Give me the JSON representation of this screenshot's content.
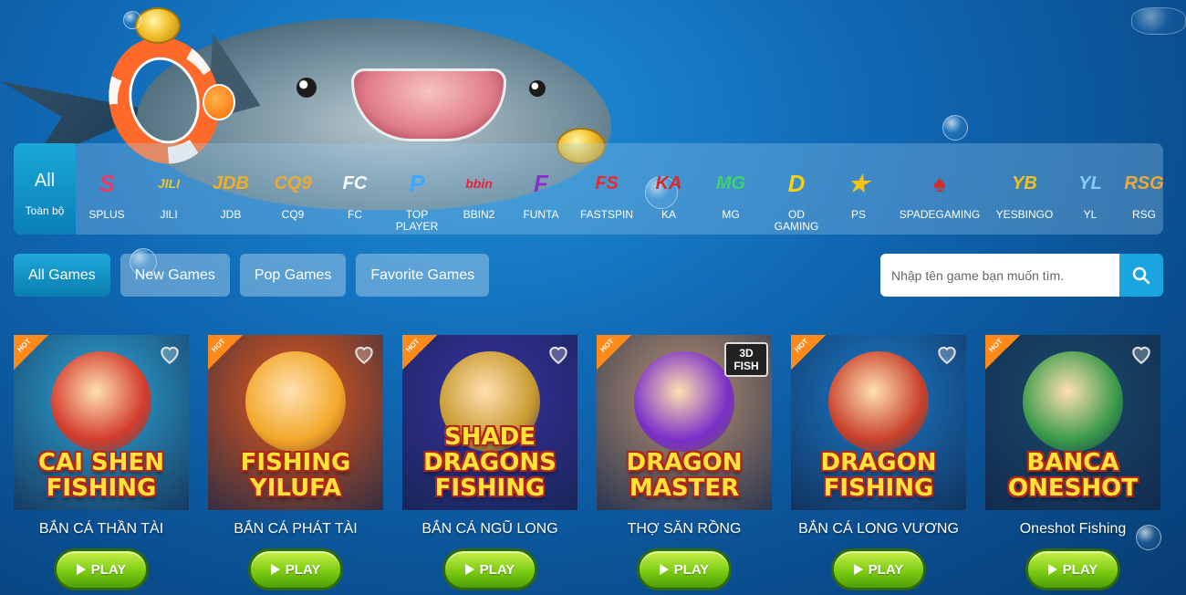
{
  "providers": {
    "all_big": "All",
    "all_small": "Toàn bộ",
    "items": [
      {
        "label": "SPLUS",
        "logo_text": "S",
        "color": "#e83b6a"
      },
      {
        "label": "JILI",
        "logo_text": "JILI",
        "color": "#f2c230"
      },
      {
        "label": "JDB",
        "logo_text": "JDB",
        "color": "#f2b01e"
      },
      {
        "label": "CQ9",
        "logo_text": "CQ9",
        "color": "#f0a830"
      },
      {
        "label": "FC",
        "logo_text": "FC",
        "color": "#ffffff"
      },
      {
        "label": "TOP PLAYER",
        "logo_text": "P",
        "color": "#3aa8ff"
      },
      {
        "label": "BBIN2",
        "logo_text": "bbin",
        "color": "#e8203c"
      },
      {
        "label": "FUNTA",
        "logo_text": "F",
        "color": "#8a2fc8"
      },
      {
        "label": "FASTSPIN",
        "logo_text": "FS",
        "color": "#f02828"
      },
      {
        "label": "KA",
        "logo_text": "KA",
        "color": "#d42a2a"
      },
      {
        "label": "MG",
        "logo_text": "MG",
        "color": "#3ed36a"
      },
      {
        "label": "OD GAMING",
        "logo_text": "D",
        "color": "#f5d21a"
      },
      {
        "label": "PS",
        "logo_text": "★",
        "color": "#f5c21a"
      },
      {
        "label": "SPADEGAMING",
        "logo_text": "♠",
        "color": "#d42a2a"
      },
      {
        "label": "YESBINGO",
        "logo_text": "YB",
        "color": "#f5c21a"
      },
      {
        "label": "YL",
        "logo_text": "YL",
        "color": "#7fd0ff"
      },
      {
        "label": "RSG",
        "logo_text": "RSG",
        "color": "#f0a830"
      }
    ]
  },
  "tabs": [
    "All Games",
    "New Games",
    "Pop Games",
    "Favorite Games"
  ],
  "search": {
    "placeholder": "Nhập tên game bạn muốn tìm."
  },
  "games": [
    {
      "name": "BẮN CÁ THẦN TÀI",
      "thumb_title": "CAI SHEN FISHING",
      "badge": "HOT",
      "bg": "#2fa6d6",
      "char": "#d23b2b"
    },
    {
      "name": "BẮN CÁ PHÁT TÀI",
      "thumb_title": "FISHING YILUFA",
      "badge": "HOT",
      "bg": "#e85a1a",
      "char": "#f2a82a"
    },
    {
      "name": "BẮN CÁ NGŨ LONG",
      "thumb_title": "SHADE DRAGONS FISHING",
      "badge": "HOT",
      "bg": "#3a2fa0",
      "char": "#c89a30"
    },
    {
      "name": "THỢ SĂN RỒNG",
      "thumb_title": "DRAGON MASTER",
      "badge": "HOT",
      "bg": "#b89070",
      "char": "#7a2fc8",
      "tag": "3D FISH"
    },
    {
      "name": "BẮN CÁ LONG VƯƠNG",
      "thumb_title": "DRAGON FISHING",
      "badge": "HOT",
      "bg": "#1a7ac8",
      "char": "#c8402a"
    },
    {
      "name": "Oneshot Fishing",
      "thumb_title": "BANCA ONESHOT",
      "badge": "HOT",
      "bg": "#1a4a6a",
      "char": "#3a9a4a"
    }
  ],
  "play_label": "PLAY"
}
